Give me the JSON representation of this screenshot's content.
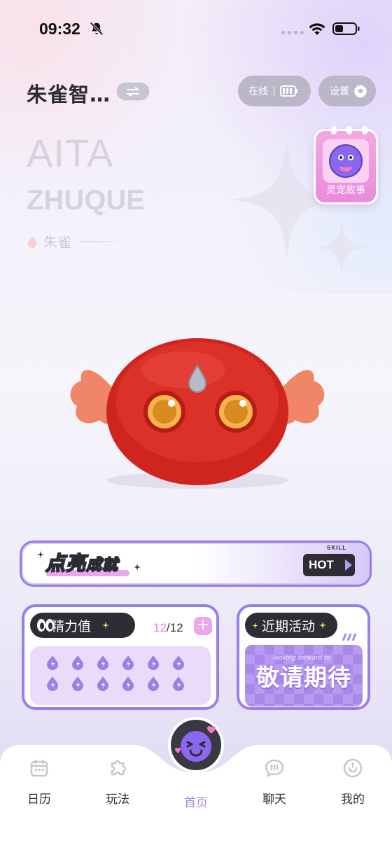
{
  "status_bar": {
    "time": "09:32"
  },
  "header": {
    "pet_name": "朱雀智…",
    "online_label": "在线",
    "settings_label": "设置"
  },
  "hero": {
    "title_line1": "AITA",
    "title_line2": "ZHUQUE",
    "species": "朱雀"
  },
  "story_card": {
    "label": "灵宠故事"
  },
  "achievement": {
    "title_main": "点亮",
    "title_sub": "成就",
    "badge": "HOT",
    "badge_small": "SKILL"
  },
  "energy": {
    "label": "精力值",
    "current": "12",
    "total": "/12",
    "drops_total": 12,
    "drops_filled": 12
  },
  "activity": {
    "label": "近期活动",
    "banner_text": "敬请期待",
    "banner_script": "looking forward to"
  },
  "nav": {
    "items": [
      {
        "label": "日历",
        "icon": "calendar-icon"
      },
      {
        "label": "玩法",
        "icon": "puzzle-icon"
      },
      {
        "label": "首页",
        "icon": "home-mascot-icon"
      },
      {
        "label": "聊天",
        "icon": "chat-icon"
      },
      {
        "label": "我的",
        "icon": "profile-icon"
      }
    ],
    "active": "首页"
  },
  "colors": {
    "accent_purple": "#9b7fe9",
    "accent_pink": "#e387d6",
    "chip_dark": "#2e2d36"
  }
}
